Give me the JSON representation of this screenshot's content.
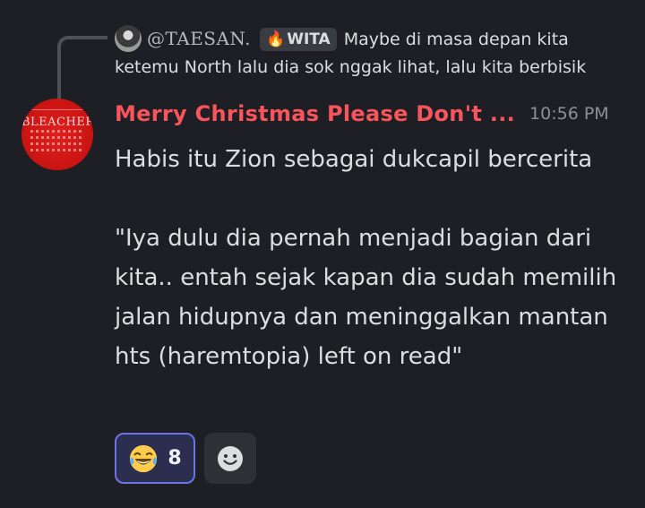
{
  "reply": {
    "author": "@TAESAN.",
    "tag": "WITA",
    "tag_icon": "fire-icon",
    "text": "Maybe di masa depan kita ketemu North lalu dia sok nggak lihat, lalu kita berbisik"
  },
  "message": {
    "username": "Merry Christmas Please Don't ...",
    "timestamp": "10:56 PM",
    "avatar_text": "BLEACHERS",
    "avatar_color": "#d01715",
    "body": "Habis itu Zion sebagai dukcapil bercerita\n\n\"Iya dulu dia pernah menjadi bagian dari kita.. entah sejak kapan dia sudah memilih jalan hidupnya dan meninggalkan mantan hts (haremtopia) left on read\""
  },
  "reactions": [
    {
      "icon": "laughing-tears-icon",
      "count": "8",
      "active": true
    }
  ],
  "add_reaction_icon": "smiley-add-reaction-icon",
  "colors": {
    "background": "#1e1f24",
    "username": "#f7545c",
    "timestamp": "#8d9097",
    "text": "#dbdee1",
    "reaction_active_border": "#6b73e6"
  }
}
